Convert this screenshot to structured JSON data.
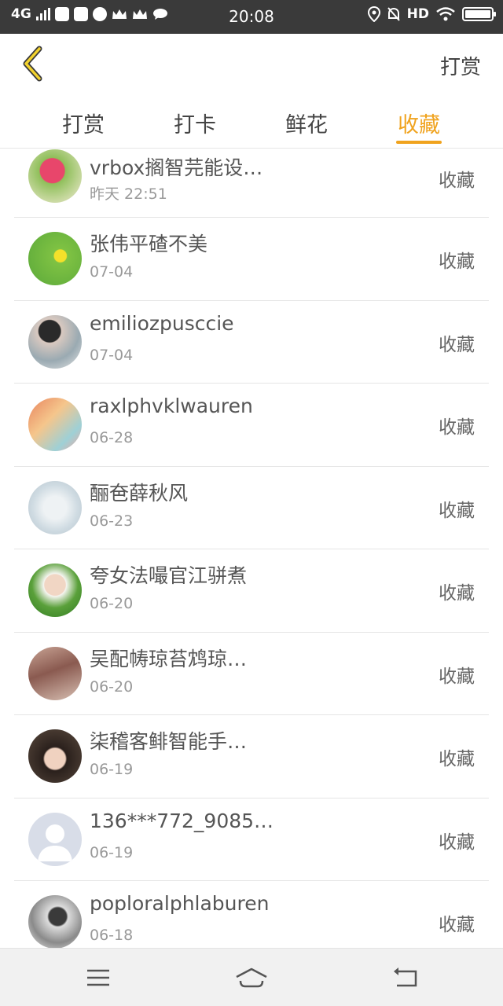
{
  "status_bar": {
    "network": "4G",
    "time": "20:08",
    "hd": "HD"
  },
  "header": {
    "back_icon": "chevron-left-icon",
    "action_label": "打赏"
  },
  "tabs": [
    {
      "label": "打赏",
      "active": false
    },
    {
      "label": "打卡",
      "active": false
    },
    {
      "label": "鲜花",
      "active": false
    },
    {
      "label": "收藏",
      "active": true
    }
  ],
  "accent_color": "#f0a31e",
  "list": [
    {
      "name": "vrbox搁智芫能设…",
      "date": "昨天 22:51",
      "action": "收藏"
    },
    {
      "name": "张伟平碴不美",
      "date": "07-04",
      "action": "收藏"
    },
    {
      "name": "emiliozpusccie",
      "date": "07-04",
      "action": "收藏"
    },
    {
      "name": "raxlphvklwauren",
      "date": "06-28",
      "action": "收藏"
    },
    {
      "name": "酾夿薛秋风",
      "date": "06-23",
      "action": "收藏"
    },
    {
      "name": "夸女法嘬官江骈煮",
      "date": "06-20",
      "action": "收藏"
    },
    {
      "name": "吴配帱琼苔鸩琼…",
      "date": "06-20",
      "action": "收藏"
    },
    {
      "name": "柒稽客鲱智能手…",
      "date": "06-19",
      "action": "收藏"
    },
    {
      "name": "136***772_9085…",
      "date": "06-19",
      "action": "收藏"
    },
    {
      "name": "poploralphlaburen",
      "date": "06-18",
      "action": "收藏"
    }
  ],
  "nav_bar": {
    "menu_icon": "menu-icon",
    "home_icon": "home-icon",
    "back_icon": "back-icon"
  }
}
